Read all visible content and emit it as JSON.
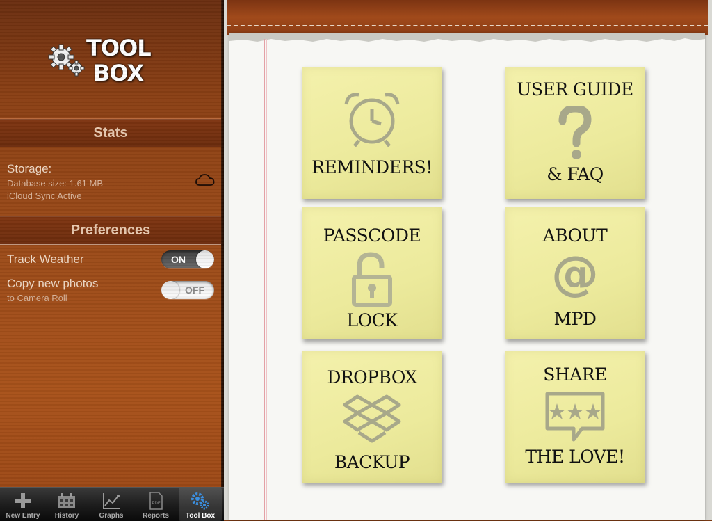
{
  "sidebar": {
    "logo_line1": "TOOL",
    "logo_line2": "BOX",
    "stats": {
      "header": "Stats",
      "title": "Storage:",
      "database_size": "Database size: 1.61 MB",
      "sync_status": "iCloud Sync Active"
    },
    "preferences": {
      "header": "Preferences",
      "track_weather": {
        "label": "Track Weather",
        "state": "ON"
      },
      "copy_photos": {
        "label": "Copy new photos",
        "sublabel": "to Camera Roll",
        "state": "OFF"
      }
    }
  },
  "tabbar": {
    "items": [
      {
        "label": "New Entry",
        "icon": "plus-icon"
      },
      {
        "label": "History",
        "icon": "calendar-icon"
      },
      {
        "label": "Graphs",
        "icon": "graph-icon"
      },
      {
        "label": "Reports",
        "icon": "pdf-icon"
      },
      {
        "label": "Tool Box",
        "icon": "gears-icon",
        "active": true
      }
    ]
  },
  "notes": {
    "reminders": {
      "label": "REMINDERS!",
      "icon": "alarm-clock-icon"
    },
    "user_guide": {
      "top": "USER GUIDE",
      "bottom": "& FAQ",
      "icon": "question-mark-icon"
    },
    "passcode": {
      "top": "PASSCODE",
      "bottom": "LOCK",
      "icon": "lock-icon"
    },
    "about": {
      "top": "ABOUT",
      "bottom": "MPD",
      "icon": "at-sign-icon",
      "symbol": "@"
    },
    "dropbox": {
      "top": "DROPBOX",
      "bottom": "BACKUP",
      "icon": "dropbox-icon"
    },
    "share": {
      "top": "SHARE",
      "bottom": "THE LOVE!",
      "icon": "stars-speech-bubble-icon"
    }
  },
  "colors": {
    "sticky_note": "#f0ee9f",
    "icon_gray": "#a8a88a",
    "leather": "#8a3c14"
  }
}
